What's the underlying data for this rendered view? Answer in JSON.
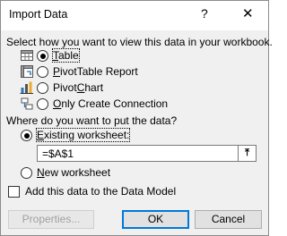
{
  "dialog": {
    "title": "Import Data",
    "help_glyph": "?",
    "close_glyph": "✕"
  },
  "view_section": {
    "prompt": "Select how you want to view this data in your workbook.",
    "options": [
      {
        "label": "Table",
        "selected": true,
        "icon": "table-icon"
      },
      {
        "label": "PivotTable Report",
        "selected": false,
        "icon": "pivottable-icon"
      },
      {
        "label": "PivotChart",
        "selected": false,
        "icon": "pivotchart-icon"
      },
      {
        "label": "Only Create Connection",
        "selected": false,
        "icon": "connection-icon"
      }
    ]
  },
  "location_section": {
    "prompt": "Where do you want to put the data?",
    "existing_label": "Existing worksheet:",
    "existing_selected": true,
    "reference_value": "=$A$1",
    "collapse_glyph": "⤒",
    "new_label": "New worksheet",
    "new_selected": false
  },
  "data_model": {
    "label": "Add this data to the Data Model",
    "checked": false
  },
  "buttons": {
    "properties": "Properties...",
    "ok": "OK",
    "cancel": "Cancel"
  }
}
